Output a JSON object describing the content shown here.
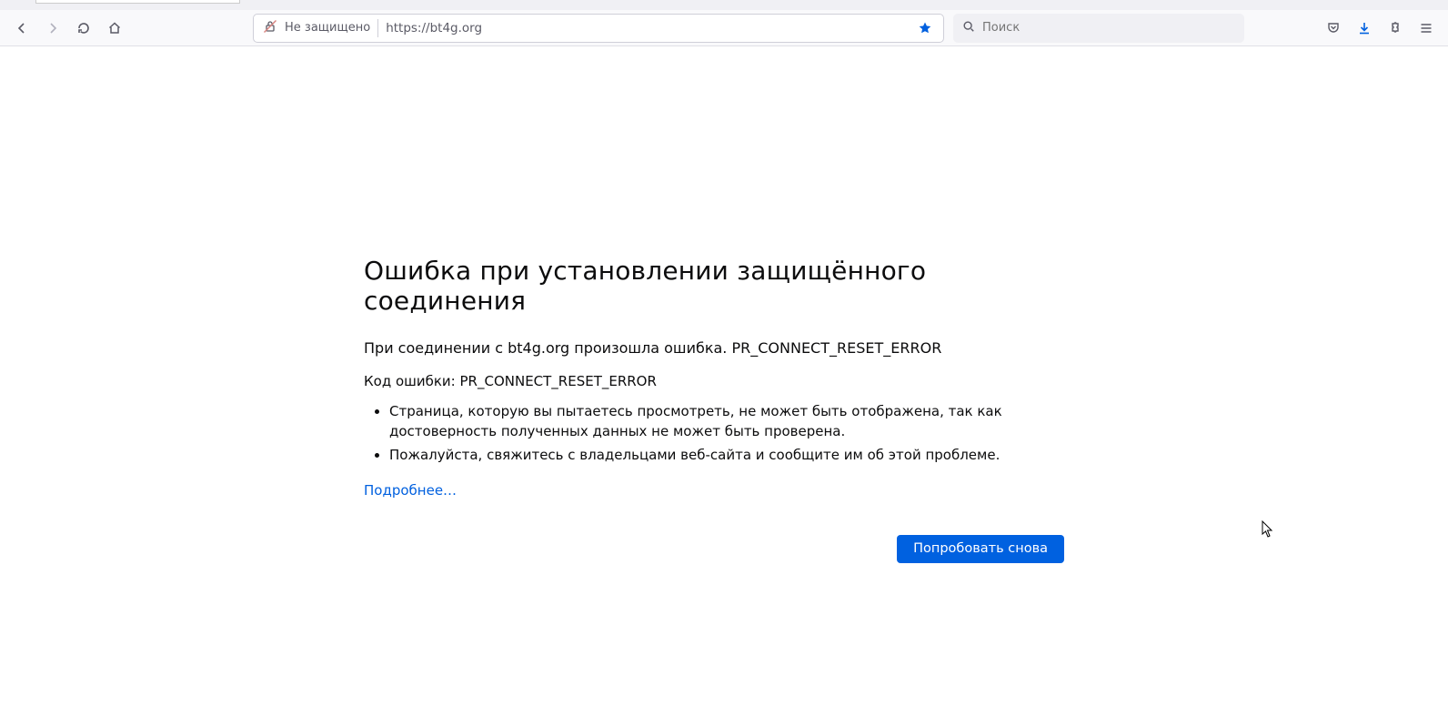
{
  "urlbar": {
    "not_secure_label": "Не защищено",
    "url_display": "https://bt4g.org"
  },
  "search": {
    "placeholder": "Поиск"
  },
  "error": {
    "title": "Ошибка при установлении защищённого соединения",
    "line1": "При соединении с bt4g.org произошла ошибка. PR_CONNECT_RESET_ERROR",
    "code_line": "Код ошибки: PR_CONNECT_RESET_ERROR",
    "bullets": [
      "Страница, которую вы пытаетесь просмотреть, не может быть отображена, так как достоверность полученных данных не может быть проверена.",
      "Пожалуйста, свяжитесь с владельцами веб-сайта и сообщите им об этой проблеме."
    ],
    "more_link": "Подробнее…",
    "retry_label": "Попробовать снова"
  }
}
